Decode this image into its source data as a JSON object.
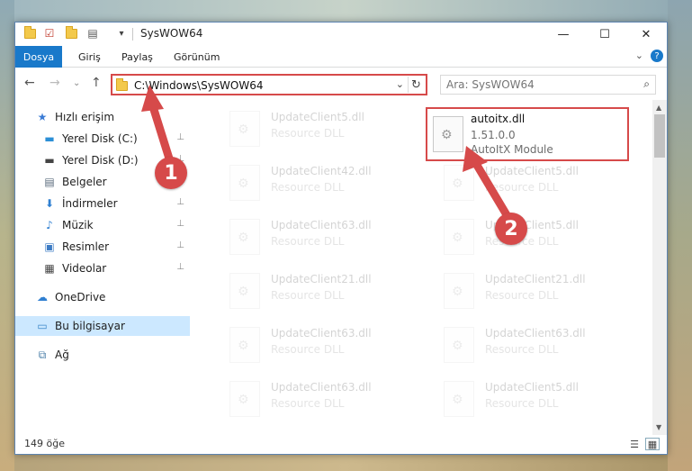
{
  "window": {
    "title": "SysWOW64",
    "minimize": "—",
    "maximize": "☐",
    "close": "✕"
  },
  "ribbon": {
    "tabs": [
      "Dosya",
      "Giriş",
      "Paylaş",
      "Görünüm"
    ],
    "expand": "⌄",
    "help": "?"
  },
  "nav": {
    "back": "←",
    "forward": "→",
    "up": "↑"
  },
  "address": {
    "path": "C:\\Windows\\SysWOW64",
    "chevron": "⌄",
    "refresh": "↻"
  },
  "search": {
    "placeholder": "Ara: SysWOW64"
  },
  "sidebar": {
    "items": [
      {
        "label": "Hızlı erişim",
        "icon": "star-icon",
        "glyph": "★",
        "pinned": false
      },
      {
        "label": "Yerel Disk (C:)",
        "icon": "drive-icon",
        "glyph": "▬",
        "pinned": true
      },
      {
        "label": "Yerel Disk (D:)",
        "icon": "drive-icon",
        "glyph": "▬",
        "pinned": true
      },
      {
        "label": "Belgeler",
        "icon": "documents-icon",
        "glyph": "▤",
        "pinned": true
      },
      {
        "label": "İndirmeler",
        "icon": "download-icon",
        "glyph": "⬇",
        "pinned": true
      },
      {
        "label": "Müzik",
        "icon": "music-icon",
        "glyph": "♪",
        "pinned": true
      },
      {
        "label": "Resimler",
        "icon": "pictures-icon",
        "glyph": "▣",
        "pinned": true
      },
      {
        "label": "Videolar",
        "icon": "videos-icon",
        "glyph": "▦",
        "pinned": true
      },
      {
        "label": "OneDrive",
        "icon": "cloud-icon",
        "glyph": "☁",
        "pinned": false
      },
      {
        "label": "Bu bilgisayar",
        "icon": "computer-icon",
        "glyph": "▭",
        "pinned": false
      },
      {
        "label": "Ağ",
        "icon": "network-icon",
        "glyph": "⧉",
        "pinned": false
      }
    ],
    "pin_glyph": "📌"
  },
  "files": {
    "left_column": [
      {
        "name": "UpdateClient5.dll",
        "desc": "Resource DLL"
      },
      {
        "name": "UpdateClient42.dll",
        "desc": "Resource DLL"
      },
      {
        "name": "UpdateClient63.dll",
        "desc": "Resource DLL"
      },
      {
        "name": "UpdateClient21.dll",
        "desc": "Resource DLL"
      },
      {
        "name": "UpdateClient63.dll",
        "desc": "Resource DLL"
      },
      {
        "name": "UpdateClient63.dll",
        "desc": "Resource DLL"
      }
    ],
    "right_column": [
      {
        "name": "UpdateClient5.dll",
        "desc": "Resource DLL"
      },
      {
        "name": "UpdateClient5.dll",
        "desc": "Resource DLL"
      },
      {
        "name": "UpdateClient21.dll",
        "desc": "Resource DLL"
      },
      {
        "name": "UpdateClient63.dll",
        "desc": "Resource DLL"
      },
      {
        "name": "UpdateClient5.dll",
        "desc": "Resource DLL"
      }
    ],
    "highlighted": {
      "name": "autoitx.dll",
      "version": "1.51.0.0",
      "desc": "AutoItX Module"
    }
  },
  "status": {
    "count": "149 öğe"
  },
  "callouts": [
    "1",
    "2"
  ],
  "colors": {
    "accent": "#1979ca",
    "annotation": "#d64a4a",
    "selected": "#cce8ff"
  }
}
